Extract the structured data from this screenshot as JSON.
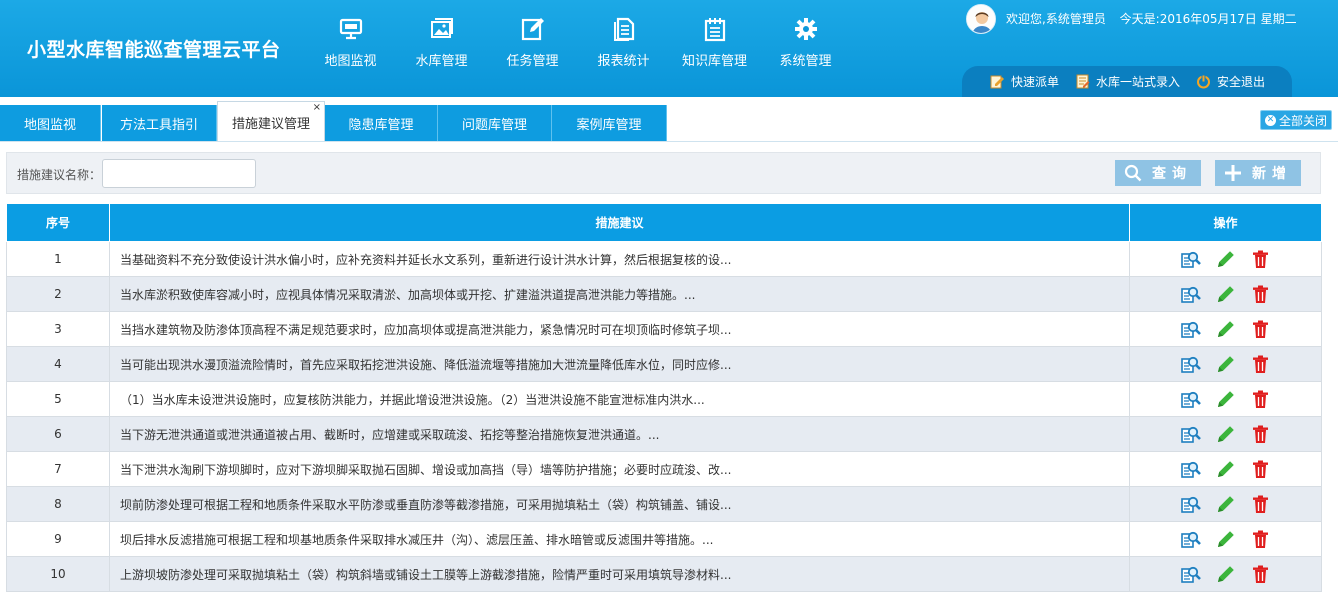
{
  "app": {
    "title": "小型水库智能巡查管理云平台"
  },
  "nav": [
    {
      "label": "地图监视",
      "icon": "monitor-icon"
    },
    {
      "label": "水库管理",
      "icon": "picture-icon"
    },
    {
      "label": "任务管理",
      "icon": "edit-icon"
    },
    {
      "label": "报表统计",
      "icon": "report-icon"
    },
    {
      "label": "知识库管理",
      "icon": "notepad-icon"
    },
    {
      "label": "系统管理",
      "icon": "gear-icon"
    }
  ],
  "user": {
    "welcome": "欢迎您,系统管理员",
    "date": "今天是:2016年05月17日 星期二"
  },
  "quick_links": [
    {
      "label": "快速派单",
      "icon": "dispatch-icon"
    },
    {
      "label": "水库一站式录入",
      "icon": "entry-icon"
    },
    {
      "label": "安全退出",
      "icon": "power-icon"
    }
  ],
  "tabs": [
    {
      "label": "地图监视",
      "active": false
    },
    {
      "label": "方法工具指引",
      "active": false
    },
    {
      "label": "措施建议管理",
      "active": true,
      "close": "×"
    },
    {
      "label": "隐患库管理",
      "active": false
    },
    {
      "label": "问题库管理",
      "active": false
    },
    {
      "label": "案例库管理",
      "active": false
    }
  ],
  "close_all": "全部关闭",
  "search": {
    "label": "措施建议名称：",
    "value": "",
    "query_button": "查询",
    "add_button": "新增"
  },
  "table": {
    "columns": [
      "序号",
      "措施建议",
      "操作"
    ],
    "rows": [
      {
        "no": "1",
        "text": "当基础资料不充分致使设计洪水偏小时，应补充资料并延长水文系列，重新进行设计洪水计算，然后根据复核的设..."
      },
      {
        "no": "2",
        "text": "当水库淤积致使库容减小时，应视具体情况采取清淤、加高坝体或开挖、扩建溢洪道提高泄洪能力等措施。..."
      },
      {
        "no": "3",
        "text": "当挡水建筑物及防渗体顶高程不满足规范要求时，应加高坝体或提高泄洪能力，紧急情况时可在坝顶临时修筑子坝..."
      },
      {
        "no": "4",
        "text": "当可能出现洪水漫顶溢流险情时，首先应采取拓挖泄洪设施、降低溢流堰等措施加大泄流量降低库水位，同时应修..."
      },
      {
        "no": "5",
        "text": "（1）当水库未设泄洪设施时，应复核防洪能力，并据此增设泄洪设施。（2）当泄洪设施不能宣泄标准内洪水..."
      },
      {
        "no": "6",
        "text": "当下游无泄洪通道或泄洪通道被占用、截断时，应增建或采取疏浚、拓挖等整治措施恢复泄洪通道。..."
      },
      {
        "no": "7",
        "text": "当下泄洪水淘刷下游坝脚时，应对下游坝脚采取抛石固脚、增设或加高挡（导）墙等防护措施；必要时应疏浚、改..."
      },
      {
        "no": "8",
        "text": "坝前防渗处理可根据工程和地质条件采取水平防渗或垂直防渗等截渗措施，可采用抛填粘土（袋）构筑铺盖、铺设..."
      },
      {
        "no": "9",
        "text": "坝后排水反滤措施可根据工程和坝基地质条件采取排水减压井（沟）、滤层压盖、排水暗管或反滤围井等措施。..."
      },
      {
        "no": "10",
        "text": "上游坝坡防渗处理可采取抛填粘土（袋）构筑斜墙或铺设土工膜等上游截渗措施，险情严重时可采用填筑导渗材料..."
      }
    ]
  }
}
